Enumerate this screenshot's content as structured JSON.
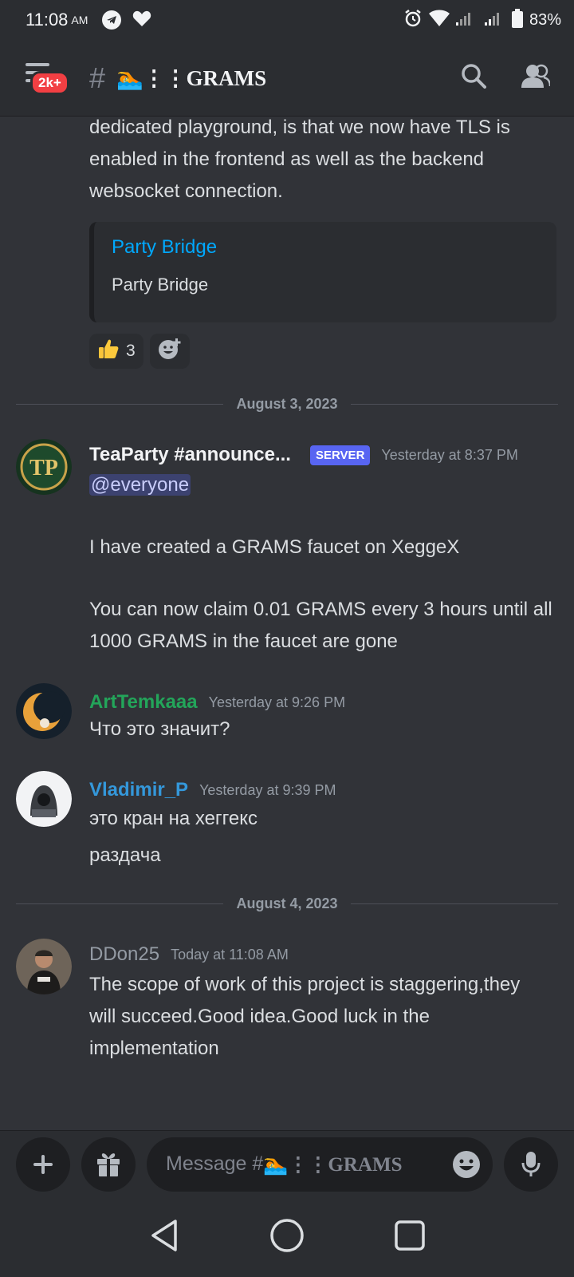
{
  "status": {
    "time": "11:08",
    "ampm": "AM",
    "battery": "83%"
  },
  "header": {
    "badge": "2k+",
    "channel": "🏊⋮⋮GRAMS"
  },
  "continued": {
    "text": "dedicated playground, is that we now have TLS is enabled in the frontend as well as the backend websocket connection.",
    "embed_title": "Party Bridge",
    "embed_desc": "Party Bridge",
    "reaction_count": "3"
  },
  "dividers": [
    "August 3, 2023",
    "August 4, 2023"
  ],
  "messages": [
    {
      "author": "TeaParty #announce...",
      "tag": "SERVER",
      "time": "Yesterday at 8:37 PM",
      "mention": "@everyone",
      "lines": [
        "I have created a GRAMS faucet on XeggeX",
        "You can now claim 0.01 GRAMS every 3 hours until all 1000 GRAMS in the faucet are gone"
      ],
      "color": "#f2f3f5"
    },
    {
      "author": "ArtTemkaaa",
      "time": "Yesterday at 9:26 PM",
      "lines": [
        "Что это значит?"
      ],
      "color": "#23a55a"
    },
    {
      "author": "Vladimir_P",
      "time": "Yesterday at 9:39 PM",
      "lines": [
        "это кран на хеггекс",
        "раздача"
      ],
      "color": "#3498db"
    },
    {
      "author": "DDon25",
      "time": "Today at 11:08 AM",
      "lines": [
        "The scope of work of this project is staggering,they will succeed.Good idea.Good luck in the implementation"
      ],
      "color": "#949ba4"
    }
  ],
  "composer": {
    "placeholder_prefix": "Message #",
    "placeholder_channel": "🏊⋮⋮GRAMS"
  }
}
